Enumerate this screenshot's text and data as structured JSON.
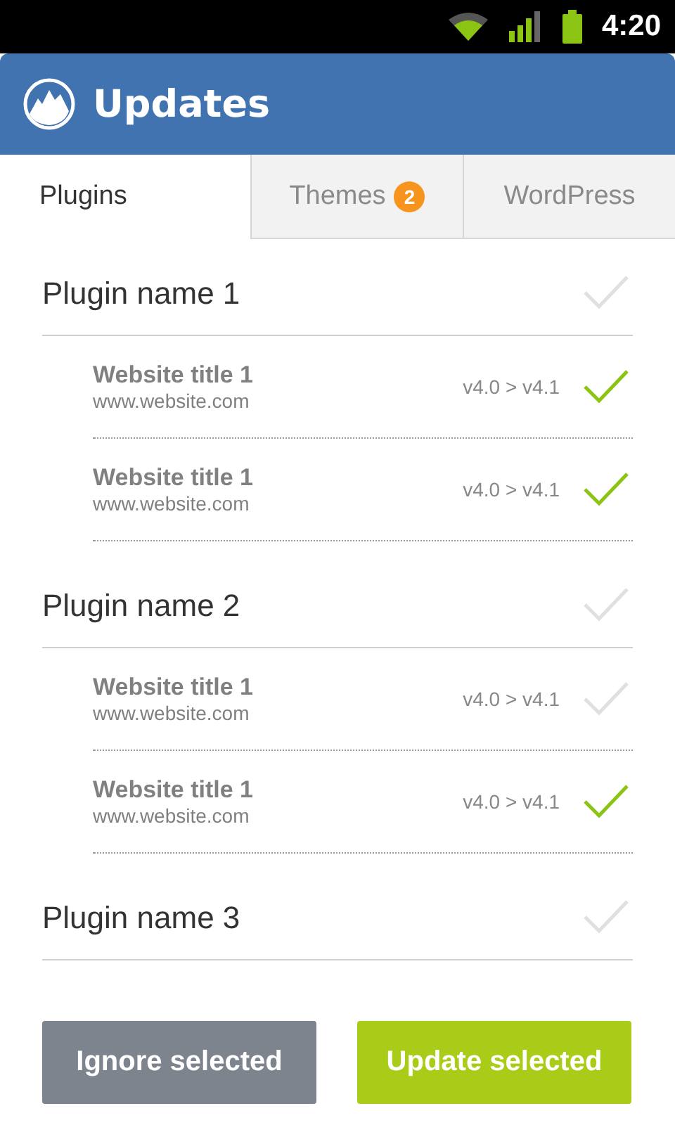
{
  "status_bar": {
    "time": "4:20"
  },
  "header": {
    "title": "Updates"
  },
  "tabs": [
    {
      "label": "Plugins",
      "selected": true
    },
    {
      "label": "Themes",
      "badge": "2",
      "selected": false
    },
    {
      "label": "WordPress",
      "selected": false
    }
  ],
  "plugins": [
    {
      "name": "Plugin name 1",
      "checked": false,
      "sites": [
        {
          "title": "Website title 1",
          "url": "www.website.com",
          "version": "v4.0 > v4.1",
          "checked": true
        },
        {
          "title": "Website title 1",
          "url": "www.website.com",
          "version": "v4.0 > v4.1",
          "checked": true
        }
      ]
    },
    {
      "name": "Plugin name 2",
      "checked": false,
      "sites": [
        {
          "title": "Website title 1",
          "url": "www.website.com",
          "version": "v4.0 > v4.1",
          "checked": false
        },
        {
          "title": "Website title 1",
          "url": "www.website.com",
          "version": "v4.0 > v4.1",
          "checked": true
        }
      ]
    },
    {
      "name": "Plugin name 3",
      "checked": false
    }
  ],
  "buttons": [
    {
      "label": "Ignore selected",
      "kind": "secondary"
    },
    {
      "label": "Update selected",
      "kind": "primary"
    }
  ]
}
